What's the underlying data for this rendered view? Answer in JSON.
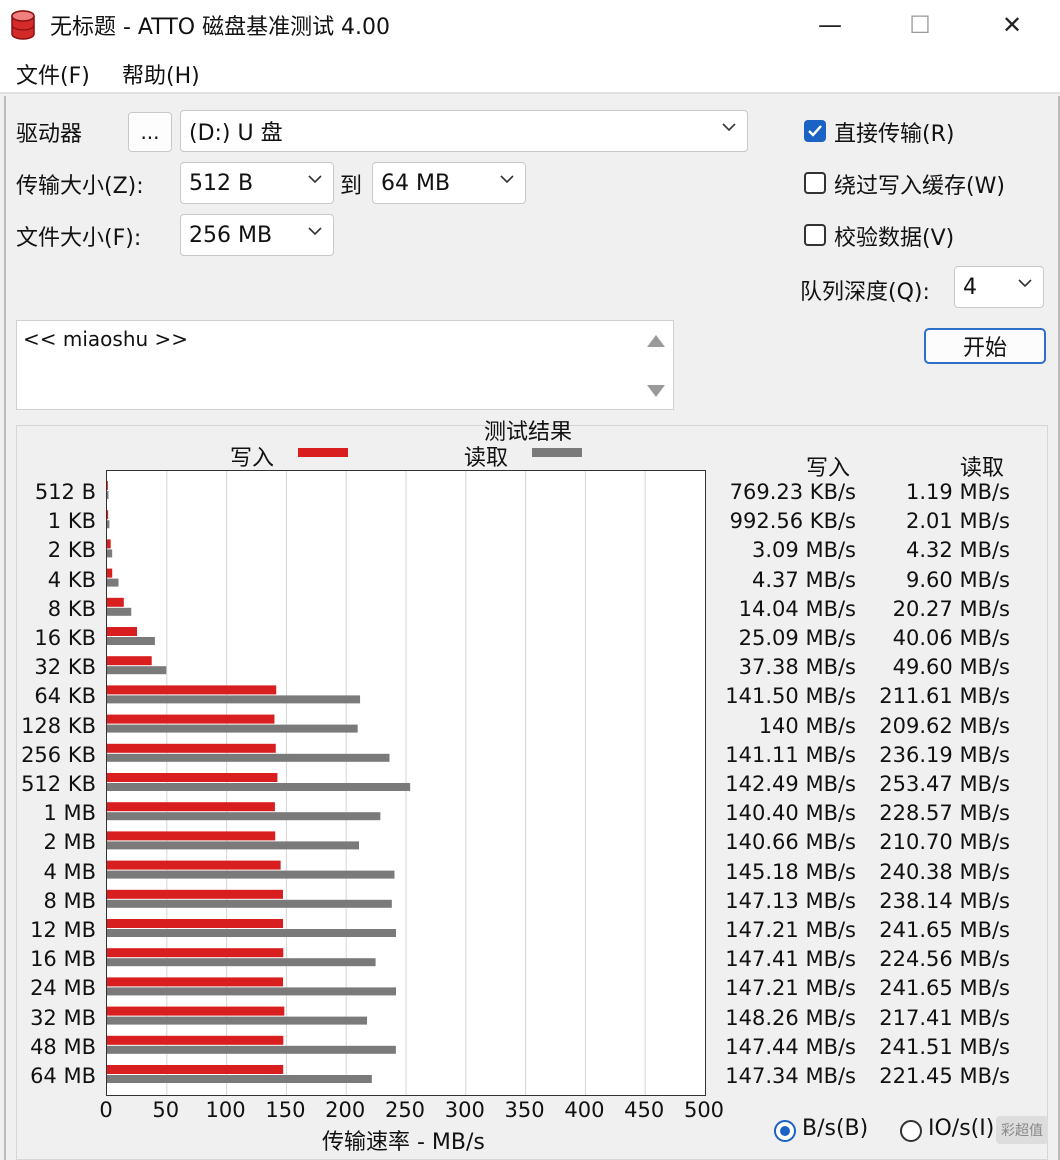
{
  "window": {
    "title": "无标题 - ATTO 磁盘基准测试 4.00",
    "icon": "database-icon",
    "controls": {
      "minimize": "—",
      "maximize": "☐",
      "close": "✕"
    }
  },
  "menu": {
    "file": "文件(F)",
    "help": "帮助(H)"
  },
  "settings": {
    "drive_label": "驱动器",
    "browse_button": "...",
    "drive_value": "(D:) U 盘",
    "transfer_size_label": "传输大小(Z):",
    "transfer_from": "512 B",
    "to_label": "到",
    "transfer_to": "64 MB",
    "file_size_label": "文件大小(F):",
    "file_size": "256 MB",
    "direct_io_label": "直接传输(R)",
    "direct_io_checked": true,
    "bypass_cache_label": "绕过写入缓存(W)",
    "bypass_cache_checked": false,
    "verify_label": "校验数据(V)",
    "verify_checked": false,
    "queue_depth_label": "队列深度(Q):",
    "queue_depth": "4",
    "start_button": "开始"
  },
  "description": "<< miaoshu >>",
  "results": {
    "title": "测试结果",
    "legend_write": "写入",
    "legend_read": "读取",
    "col_write": "写入",
    "col_read": "读取",
    "unit_bytes_label": "B/s(B)",
    "unit_io_label": "IO/s(I)",
    "unit_selected": "B/s",
    "watermark": "彩超值"
  },
  "chart_data": {
    "type": "bar",
    "orientation": "horizontal",
    "xlabel": "传输速率 - MB/s",
    "xlim": [
      0,
      500
    ],
    "xticks": [
      0,
      50,
      100,
      150,
      200,
      250,
      300,
      350,
      400,
      450,
      500
    ],
    "grid": true,
    "colors": {
      "write": "#d81e1e",
      "read": "#7a7a7a"
    },
    "categories": [
      "512 B",
      "1 KB",
      "2 KB",
      "4 KB",
      "8 KB",
      "16 KB",
      "32 KB",
      "64 KB",
      "128 KB",
      "256 KB",
      "512 KB",
      "1 MB",
      "2 MB",
      "4 MB",
      "8 MB",
      "12 MB",
      "16 MB",
      "24 MB",
      "32 MB",
      "48 MB",
      "64 MB"
    ],
    "series": [
      {
        "name": "写入",
        "values": [
          0.75,
          0.97,
          3.09,
          4.37,
          14.04,
          25.09,
          37.38,
          141.5,
          140,
          141.11,
          142.49,
          140.4,
          140.66,
          145.18,
          147.13,
          147.21,
          147.41,
          147.21,
          148.26,
          147.44,
          147.34
        ]
      },
      {
        "name": "读取",
        "values": [
          1.19,
          2.01,
          4.32,
          9.6,
          20.27,
          40.06,
          49.6,
          211.61,
          209.62,
          236.19,
          253.47,
          228.57,
          210.7,
          240.38,
          238.14,
          241.65,
          224.56,
          241.65,
          217.41,
          241.51,
          221.45
        ]
      }
    ],
    "write_labels": [
      "769.23 KB/s",
      "992.56 KB/s",
      "3.09 MB/s",
      "4.37 MB/s",
      "14.04 MB/s",
      "25.09 MB/s",
      "37.38 MB/s",
      "141.50 MB/s",
      "140 MB/s",
      "141.11 MB/s",
      "142.49 MB/s",
      "140.40 MB/s",
      "140.66 MB/s",
      "145.18 MB/s",
      "147.13 MB/s",
      "147.21 MB/s",
      "147.41 MB/s",
      "147.21 MB/s",
      "148.26 MB/s",
      "147.44 MB/s",
      "147.34 MB/s"
    ],
    "read_labels": [
      "1.19 MB/s",
      "2.01 MB/s",
      "4.32 MB/s",
      "9.60 MB/s",
      "20.27 MB/s",
      "40.06 MB/s",
      "49.60 MB/s",
      "211.61 MB/s",
      "209.62 MB/s",
      "236.19 MB/s",
      "253.47 MB/s",
      "228.57 MB/s",
      "210.70 MB/s",
      "240.38 MB/s",
      "238.14 MB/s",
      "241.65 MB/s",
      "224.56 MB/s",
      "241.65 MB/s",
      "217.41 MB/s",
      "241.51 MB/s",
      "221.45 MB/s"
    ]
  }
}
